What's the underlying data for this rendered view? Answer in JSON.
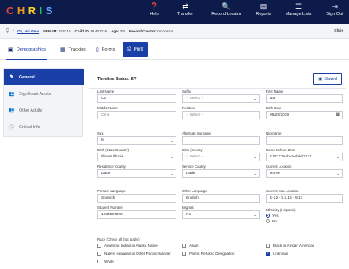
{
  "app": {
    "logo_letters": [
      "C",
      "H",
      "R",
      "I",
      "S"
    ],
    "logo_colors": [
      "#e8433b",
      "#f39a1d",
      "#ffd21f",
      "#2fbf5a",
      "#5fa8ff"
    ],
    "nav": [
      {
        "label": "Help",
        "icon": "help-circle-icon",
        "glyph": "❓"
      },
      {
        "label": "Transfer",
        "icon": "transfer-icon",
        "glyph": "⇄"
      },
      {
        "label": "Record Locator",
        "icon": "search-icon",
        "glyph": "🔍"
      },
      {
        "label": "Reports",
        "icon": "report-icon",
        "glyph": "▤"
      },
      {
        "label": "Manage Lists",
        "icon": "list-icon",
        "glyph": "☰"
      },
      {
        "label": "Sign Out",
        "icon": "sign-out-icon",
        "glyph": "⇥"
      }
    ]
  },
  "patient": {
    "name": "Oz, Nai Oma",
    "dbnum_label": "DBNUM:",
    "dbnum": "614310",
    "child_id_label": "Child ID:",
    "child_id": "61431016",
    "age_label": "Age:",
    "age": "2/3",
    "record_creator_label": "Record Creator:",
    "record_creator": "mcoustor",
    "right_label": "Chris"
  },
  "tabs": [
    {
      "label": "Demographics",
      "icon": "id-card-icon",
      "glyph": "▣"
    },
    {
      "label": "Tracking",
      "icon": "calendar-icon",
      "glyph": "▦"
    },
    {
      "label": "Forms",
      "icon": "file-icon",
      "glyph": "▯"
    }
  ],
  "print_label": "Print",
  "sidebar": [
    {
      "label": "General",
      "icon": "pencil-icon",
      "glyph": "✎"
    },
    {
      "label": "Significant Adults",
      "icon": "users-icon",
      "glyph": "👥"
    },
    {
      "label": "Other Adults",
      "icon": "users-icon",
      "glyph": "👥"
    },
    {
      "label": "Critical Info",
      "icon": "info-icon",
      "glyph": "ⓘ"
    }
  ],
  "timeline_status": "Timeline Status: EV",
  "saved_label": "Saved",
  "fields": {
    "last_name": {
      "label": "Last Name",
      "value": "Oz"
    },
    "suffix": {
      "label": "Suffix",
      "value": "-- Select --"
    },
    "first_name": {
      "label": "First Name",
      "value": "Nai"
    },
    "middle_name": {
      "label": "Middle Name",
      "value": "Oma"
    },
    "relation": {
      "label": "Relation",
      "value": "-- Select --"
    },
    "birth_date": {
      "label": "Birth Date",
      "value": "09/25/2018"
    },
    "sex": {
      "label": "Sex",
      "value": "M"
    },
    "alt_surname": {
      "label": "Alternate Surname",
      "value": ""
    },
    "nickname": {
      "label": "Nickname",
      "value": ""
    },
    "birth_state": {
      "label": "Birth (State/Country)",
      "value": "Illinois Illinois"
    },
    "birth_county": {
      "label": "Birth (County)",
      "value": "-- Select --"
    },
    "home_school_zone": {
      "label": "Home School Zone",
      "value": "CSC C/Auburndale/2121"
    },
    "residence_county": {
      "label": "Residence County",
      "value": "Dade"
    },
    "service_county": {
      "label": "Service County",
      "value": "Dade"
    },
    "current_location": {
      "label": "Current Location",
      "value": "Home"
    },
    "primary_language": {
      "label": "Primary Language",
      "value": "Spanish"
    },
    "other_language": {
      "label": "Other Language",
      "value": "English"
    },
    "current_sub_location": {
      "label": "Current Sub Location",
      "value": "K-22 - 9.2.16 - 9.17"
    },
    "student_number": {
      "label": "Student Number",
      "value": "1234567890"
    },
    "migrant": {
      "label": "Migrant",
      "value": "No"
    },
    "ethnicity": {
      "label": "Ethnicity (Hispanic)",
      "yes": "Yes",
      "no": "No",
      "selected": "Yes"
    }
  },
  "race": {
    "title": "Race (Check all that apply.)",
    "options": [
      {
        "label": "American Indian or Alaska Native",
        "checked": false
      },
      {
        "label": "Asian",
        "checked": false
      },
      {
        "label": "Black or African American",
        "checked": false
      },
      {
        "label": "Native Hawaiian or Other Pacific Islander",
        "checked": false
      },
      {
        "label": "Parent Refused Designation",
        "checked": false
      },
      {
        "label": "Unknown",
        "checked": true
      },
      {
        "label": "White",
        "checked": false
      }
    ]
  }
}
